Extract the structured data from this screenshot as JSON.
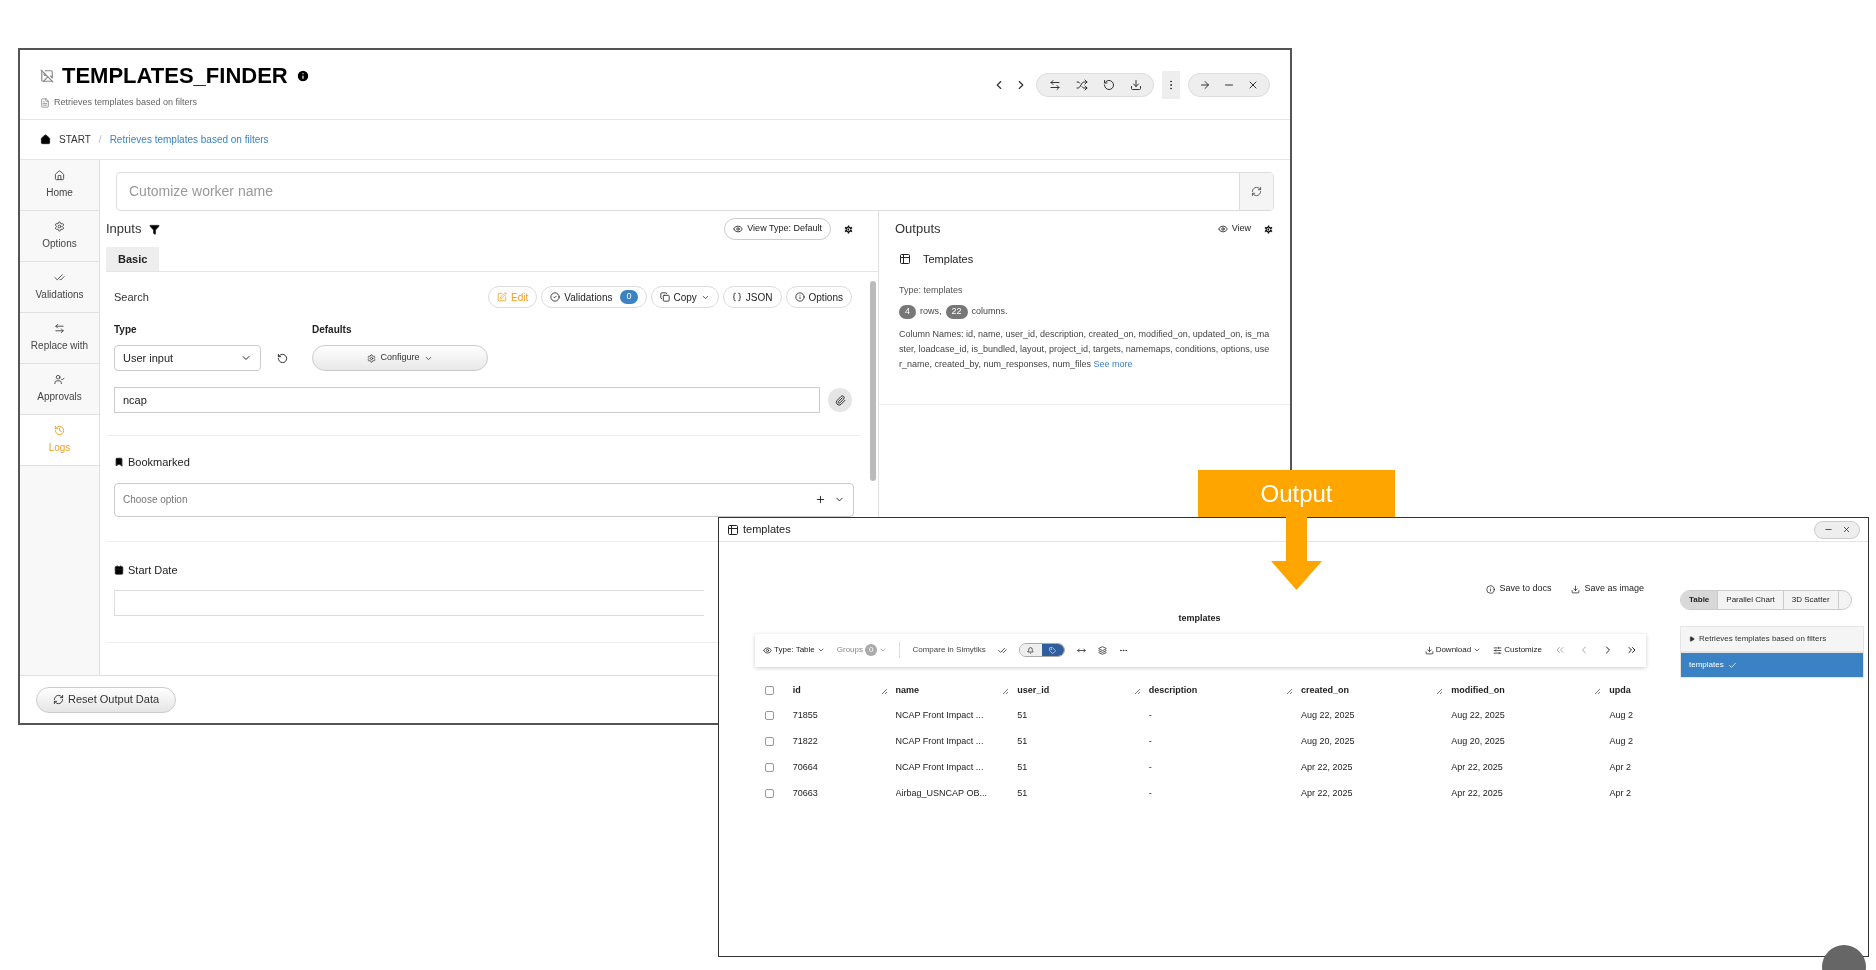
{
  "main_window": {
    "title": "TEMPLATES_FINDER",
    "subtitle": "Retrieves templates based on filters",
    "breadcrumb": [
      {
        "label": "START"
      },
      {
        "separator": "/",
        "label": "Retrieves templates based on filters"
      }
    ],
    "sidebar": [
      {
        "label": "Home",
        "selected": false
      },
      {
        "label": "Options",
        "selected": false
      },
      {
        "label": "Validations",
        "selected": false
      },
      {
        "label": "Replace with",
        "selected": false
      },
      {
        "label": "Approvals",
        "selected": false
      },
      {
        "label": "Logs",
        "selected": true
      }
    ],
    "worker_name": {
      "placeholder": "Cutomize worker name"
    },
    "inputs": {
      "title": "Inputs",
      "view_type": "View Type: Default",
      "tabs": [
        {
          "label": "Basic",
          "selected": true
        }
      ],
      "search": {
        "label": "Search",
        "actions": [
          {
            "kind": "edit",
            "label": "Edit"
          },
          {
            "kind": "validations",
            "label": "Validations",
            "count": "0"
          },
          {
            "kind": "copy",
            "label": "Copy"
          },
          {
            "kind": "json",
            "label": "JSON"
          },
          {
            "kind": "options",
            "label": "Options"
          }
        ],
        "type_label": "Type",
        "type_value": "User input",
        "defaults_label": "Defaults",
        "configure": "Configure",
        "value": "ncap"
      },
      "bookmarked": {
        "label": "Bookmarked",
        "placeholder": "Choose option"
      },
      "start_date": {
        "label": "Start Date"
      }
    },
    "outputs": {
      "title": "Outputs",
      "view": "View",
      "item": {
        "title": "Templates",
        "type": "Type: templates",
        "rows": "4",
        "rows_label": "rows,",
        "columns": "22",
        "columns_label": "columns.",
        "column_names": "Column Names: id, name, user_id, description, created_on, modified_on, updated_on, is_master, loadcase_id, is_bundled, layout, project_id, targets, namemaps, conditions, options, user_name, created_by, num_responses, num_files",
        "see_more": "See more"
      }
    },
    "reset_button": "Reset Output Data"
  },
  "callout": {
    "label": "Output"
  },
  "table_window": {
    "title": "templates",
    "actions": [
      "Save to docs",
      "Save as image"
    ],
    "view_tabs": [
      {
        "label": "Table",
        "selected": true
      },
      {
        "label": "Parallel Chart",
        "selected": false
      },
      {
        "label": "3D Scatter",
        "selected": false
      }
    ],
    "tree": [
      {
        "label": "Retrieves templates based on filters",
        "expanded": false,
        "selected": false
      },
      {
        "label": "templates",
        "selected": true
      }
    ],
    "table_title": "templates",
    "toolbar": {
      "type": "Type: Table",
      "groups": "Groups",
      "groups_count": "0",
      "compare": "Compare in Simytiks",
      "toggles": [
        {
          "selected": false
        },
        {
          "selected": true
        }
      ],
      "download": "Download",
      "customize": "Customize"
    },
    "all_checked": false,
    "columns": [
      "id",
      "name",
      "user_id",
      "description",
      "created_on",
      "modified_on",
      "upda"
    ],
    "rows": [
      {
        "checked": false,
        "cells": [
          "71855",
          "NCAP Front Impact ...",
          "51",
          "-",
          "Aug 22, 2025",
          "Aug 22, 2025",
          "Aug 2"
        ]
      },
      {
        "checked": false,
        "cells": [
          "71822",
          "NCAP Front Impact ...",
          "51",
          "-",
          "Aug 20, 2025",
          "Aug 20, 2025",
          "Aug 2"
        ]
      },
      {
        "checked": false,
        "cells": [
          "70664",
          "NCAP Front Impact ...",
          "51",
          "-",
          "Apr 22, 2025",
          "Apr 22, 2025",
          "Apr 2"
        ]
      },
      {
        "checked": false,
        "cells": [
          "70663",
          "Airbag_USNCAP OB...",
          "51",
          "-",
          "Apr 22, 2025",
          "Apr 22, 2025",
          "Apr 2"
        ]
      }
    ]
  }
}
